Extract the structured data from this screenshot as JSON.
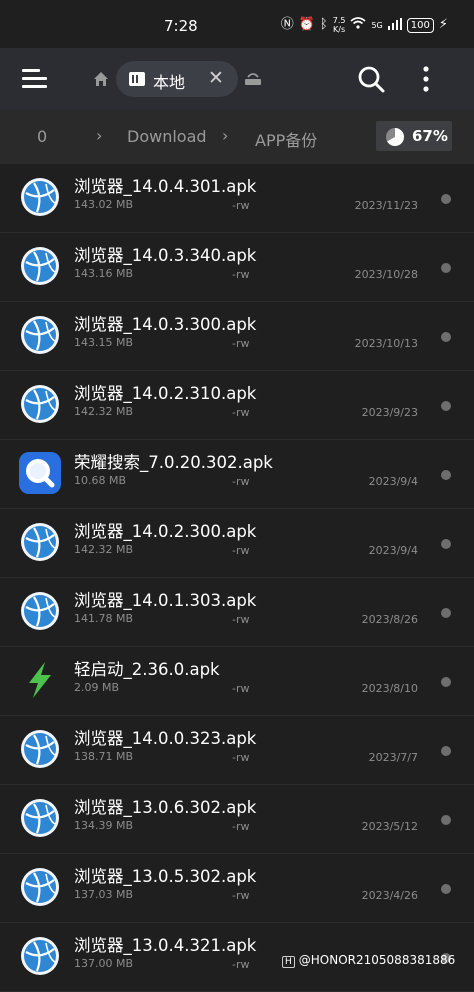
{
  "status_bar": {
    "time": "7:28",
    "icons": [
      "nfc-icon",
      "alarm-icon",
      "bluetooth-icon",
      "wifi-icon",
      "signal-icon",
      "charging-icon"
    ],
    "net_speed_value": "7.5",
    "net_speed_unit": "K/s",
    "network_type": "5G",
    "battery": "100"
  },
  "header": {
    "tab_label": "本地",
    "tab_close": "✕"
  },
  "breadcrumb": {
    "items": [
      "0",
      "Download",
      "APP备份"
    ],
    "separator": "›",
    "storage_percent_label": "67%",
    "storage_used_fraction": 0.67
  },
  "files": [
    {
      "name": "浏览器_14.0.4.301.apk",
      "size": "143.02 MB",
      "perm": "-rw",
      "date": "2023/11/23",
      "icon": "browser-icon"
    },
    {
      "name": "浏览器_14.0.3.340.apk",
      "size": "143.16 MB",
      "perm": "-rw",
      "date": "2023/10/28",
      "icon": "browser-icon"
    },
    {
      "name": "浏览器_14.0.3.300.apk",
      "size": "143.15 MB",
      "perm": "-rw",
      "date": "2023/10/13",
      "icon": "browser-icon"
    },
    {
      "name": "浏览器_14.0.2.310.apk",
      "size": "142.32 MB",
      "perm": "-rw",
      "date": "2023/9/23",
      "icon": "browser-icon"
    },
    {
      "name": "荣耀搜索_7.0.20.302.apk",
      "size": "10.68 MB",
      "perm": "-rw",
      "date": "2023/9/4",
      "icon": "search-app-icon"
    },
    {
      "name": "浏览器_14.0.2.300.apk",
      "size": "142.32 MB",
      "perm": "-rw",
      "date": "2023/9/4",
      "icon": "browser-icon"
    },
    {
      "name": "浏览器_14.0.1.303.apk",
      "size": "141.78 MB",
      "perm": "-rw",
      "date": "2023/8/26",
      "icon": "browser-icon"
    },
    {
      "name": "轻启动_2.36.0.apk",
      "size": "2.09 MB",
      "perm": "-rw",
      "date": "2023/8/10",
      "icon": "lightning-icon"
    },
    {
      "name": "浏览器_14.0.0.323.apk",
      "size": "138.71 MB",
      "perm": "-rw",
      "date": "2023/7/7",
      "icon": "browser-icon"
    },
    {
      "name": "浏览器_13.0.6.302.apk",
      "size": "134.39 MB",
      "perm": "-rw",
      "date": "2023/5/12",
      "icon": "browser-icon"
    },
    {
      "name": "浏览器_13.0.5.302.apk",
      "size": "137.03 MB",
      "perm": "-rw",
      "date": "2023/4/26",
      "icon": "browser-icon"
    },
    {
      "name": "浏览器_13.0.4.321.apk",
      "size": "137.00 MB",
      "perm": "-rw",
      "date": "",
      "icon": "browser-icon"
    }
  ],
  "watermark": {
    "badge": "H",
    "text": "@HONOR2105088381886"
  },
  "colors": {
    "background": "#1f1f1f",
    "header": "#2b2d33",
    "breadcrumb_bar": "#2a2a2a",
    "browser_blue": "#2f86d3",
    "search_app_blue": "#2a6fe0",
    "lightning_green": "#4cc24c"
  }
}
